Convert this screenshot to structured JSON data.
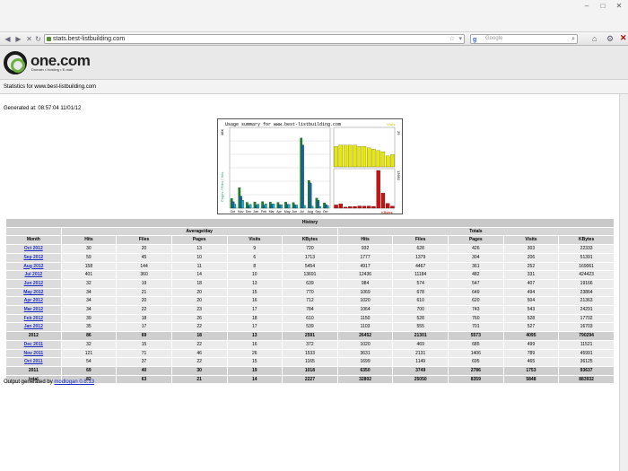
{
  "browser": {
    "url_host": "stats.best-listbuilding.com",
    "search_placeholder": "Google"
  },
  "header": {
    "logo_text": "one.com",
    "tagline": "Domain • Hosting • E-mail",
    "stats_title": "Statistics for www.best-listbuilding.com"
  },
  "generated": "Generated at: 08:57:04 11/01/12",
  "chart_data": {
    "type": "bar",
    "title": "Usage summary for www.best-listbuilding.com",
    "panels": {
      "left": {
        "ymax_label": "48K",
        "left_axis_text": "Pages / Files / Hits",
        "categories": [
          "Oct",
          "Nov",
          "Dec",
          "Jan",
          "Feb",
          "Mar",
          "Apr",
          "May",
          "Jun",
          "Jul",
          "Aug",
          "Sep",
          "Oct"
        ],
        "series": [
          {
            "name": "Hits",
            "color": "#1a8a1a",
            "values": [
              1699,
              3631,
              1020,
              1103,
              1150,
              1064,
              1020,
              1069,
              984,
              12436,
              4917,
              1777,
              932
            ]
          },
          {
            "name": "Files",
            "color": "#1a5fc8",
            "values": [
              1149,
              2131,
              469,
              555,
              528,
              700,
              610,
              678,
              574,
              11184,
              4467,
              1379,
              628
            ]
          },
          {
            "name": "Pages",
            "color": "#1bb0b8",
            "values": [
              695,
              1406,
              685,
              701,
              760,
              743,
              620,
              649,
              547,
              482,
              361,
              304,
              426
            ]
          }
        ]
      },
      "right_top": {
        "label": "Visits",
        "ymax_label": "29",
        "color": "#e8e800",
        "values": [
          15,
          16,
          16,
          16,
          16,
          15,
          15,
          14,
          13,
          12,
          11,
          8,
          9
        ]
      },
      "right_bottom": {
        "label": "KBytes",
        "ymax_label": "13691",
        "color": "#cc1010",
        "values": [
          1165,
          1533,
          372,
          539,
          610,
          784,
          712,
          770,
          639,
          13691,
          5454,
          1713,
          720
        ]
      }
    }
  },
  "table": {
    "title": "History",
    "group_headers": {
      "avg": "Average/day",
      "totals": "Totals"
    },
    "columns": [
      "Month",
      "Hits",
      "Files",
      "Pages",
      "Visits",
      "KBytes",
      "Hits",
      "Files",
      "Pages",
      "Visits",
      "KBytes"
    ],
    "rows": [
      {
        "kind": "month",
        "cells": [
          "Oct 2012",
          "30",
          "20",
          "13",
          "9",
          "720",
          "932",
          "628",
          "426",
          "303",
          "22333"
        ]
      },
      {
        "kind": "month",
        "cells": [
          "Sep 2012",
          "59",
          "45",
          "10",
          "6",
          "1713",
          "1777",
          "1379",
          "304",
          "206",
          "51391"
        ]
      },
      {
        "kind": "month",
        "cells": [
          "Aug 2012",
          "158",
          "144",
          "11",
          "8",
          "5454",
          "4917",
          "4467",
          "361",
          "252",
          "169061"
        ]
      },
      {
        "kind": "month",
        "cells": [
          "Jul 2012",
          "401",
          "360",
          "14",
          "10",
          "13691",
          "12436",
          "11184",
          "482",
          "331",
          "424423"
        ]
      },
      {
        "kind": "month",
        "cells": [
          "Jun 2012",
          "32",
          "19",
          "18",
          "13",
          "639",
          "984",
          "574",
          "547",
          "407",
          "19166"
        ]
      },
      {
        "kind": "month",
        "cells": [
          "May 2012",
          "34",
          "21",
          "20",
          "15",
          "770",
          "1069",
          "678",
          "649",
          "494",
          "23864"
        ]
      },
      {
        "kind": "month",
        "cells": [
          "Apr 2012",
          "34",
          "20",
          "20",
          "16",
          "712",
          "1020",
          "610",
          "620",
          "504",
          "21363"
        ]
      },
      {
        "kind": "month",
        "cells": [
          "Mar 2012",
          "34",
          "22",
          "23",
          "17",
          "784",
          "1064",
          "700",
          "743",
          "543",
          "24291"
        ]
      },
      {
        "kind": "month",
        "cells": [
          "Feb 2012",
          "39",
          "18",
          "26",
          "18",
          "610",
          "1150",
          "528",
          "760",
          "528",
          "17702"
        ]
      },
      {
        "kind": "month",
        "cells": [
          "Jan 2012",
          "35",
          "17",
          "22",
          "17",
          "539",
          "1103",
          "555",
          "701",
          "527",
          "16703"
        ]
      },
      {
        "kind": "year",
        "cells": [
          "2012",
          "86",
          "69",
          "18",
          "13",
          "2591",
          "26452",
          "21301",
          "5573",
          "4095",
          "790294"
        ]
      },
      {
        "kind": "month",
        "cells": [
          "Dec 2011",
          "32",
          "15",
          "22",
          "16",
          "372",
          "1020",
          "469",
          "685",
          "499",
          "11521"
        ]
      },
      {
        "kind": "month",
        "cells": [
          "Nov 2011",
          "121",
          "71",
          "46",
          "26",
          "1533",
          "3631",
          "2131",
          "1406",
          "789",
          "45991"
        ]
      },
      {
        "kind": "month",
        "cells": [
          "Oct 2011",
          "54",
          "37",
          "22",
          "15",
          "1165",
          "1699",
          "1149",
          "695",
          "465",
          "36125"
        ]
      },
      {
        "kind": "year",
        "cells": [
          "2011",
          "69",
          "40",
          "30",
          "19",
          "1018",
          "6350",
          "3749",
          "2786",
          "1753",
          "93637"
        ]
      },
      {
        "kind": "total",
        "cells": [
          "total",
          "82",
          "63",
          "21",
          "14",
          "2227",
          "32802",
          "25050",
          "8359",
          "5848",
          "883932"
        ]
      }
    ]
  },
  "footer": {
    "prefix": "Output generated by",
    "link": "modlogan 0.8.13"
  }
}
